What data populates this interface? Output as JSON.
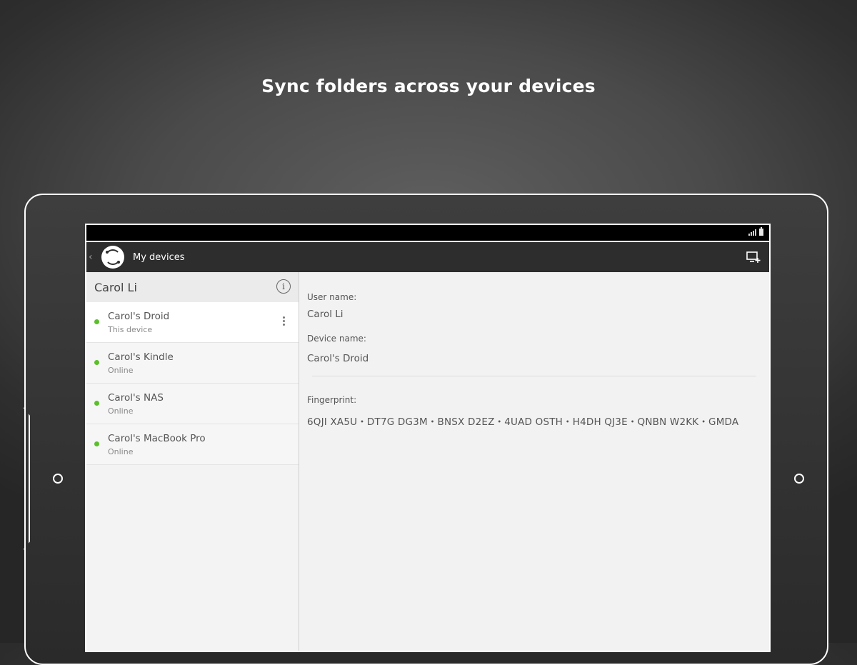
{
  "headline": "Sync folders across your devices",
  "appbar": {
    "title": "My devices",
    "back_glyph": "‹",
    "logo_icon": "sync-logo-icon",
    "action_icon": "add-device-icon"
  },
  "left_pane": {
    "user_name": "Carol Li",
    "info_glyph": "i",
    "devices": [
      {
        "name": "Carol's Droid",
        "status": "This device",
        "selected": true
      },
      {
        "name": "Carol's Kindle",
        "status": "Online"
      },
      {
        "name": "Carol's NAS",
        "status": "Online"
      },
      {
        "name": "Carol's MacBook Pro",
        "status": "Online"
      }
    ]
  },
  "details": {
    "user_label": "User name:",
    "user_value": "Carol Li",
    "device_label": "Device name:",
    "device_value": "Carol's Droid",
    "fingerprint_label": "Fingerprint:",
    "fingerprint_value": "6QJI XA5U・DT7G DG3M・BNSX D2EZ・4UAD OSTH・H4DH QJ3E・QNBN W2KK・GMDA"
  },
  "colors": {
    "online": "#5bbf2a",
    "appbar": "#2d2d2d",
    "statusbar": "#000000"
  }
}
